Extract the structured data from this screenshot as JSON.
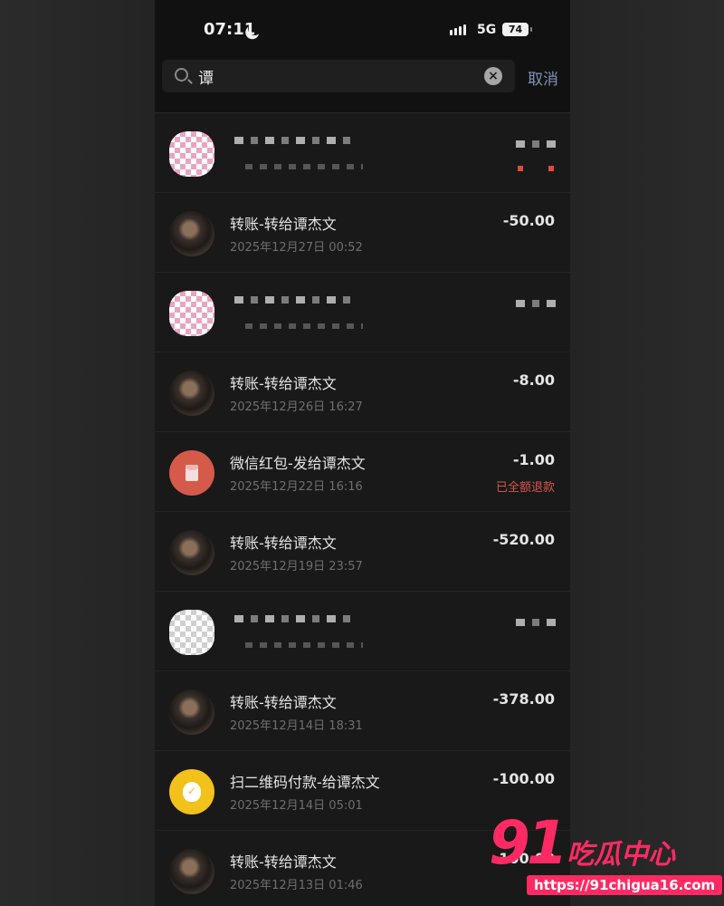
{
  "status_bar": {
    "time": "07:11",
    "network": "5G",
    "battery": "74"
  },
  "search": {
    "query": "谭",
    "cancel_label": "取消"
  },
  "transactions": [
    {
      "title": "",
      "date": "",
      "amount": "",
      "avatar": "pixel-avatar",
      "redacted": true
    },
    {
      "title": "转账-转给谭杰文",
      "date": "2025年12月27日 00:52",
      "amount": "-50.00",
      "avatar": "photo-avatar"
    },
    {
      "title": "",
      "date": "",
      "amount": "",
      "avatar": "pixel-avatar",
      "redacted": true
    },
    {
      "title": "转账-转给谭杰文",
      "date": "2025年12月26日 16:27",
      "amount": "-8.00",
      "avatar": "photo-avatar"
    },
    {
      "title": "微信红包-发给谭杰文",
      "date": "2025年12月22日 16:16",
      "amount": "-1.00",
      "status": "已全额退款",
      "avatar": "red-packet-icon"
    },
    {
      "title": "转账-转给谭杰文",
      "date": "2025年12月19日 23:57",
      "amount": "-520.00",
      "avatar": "photo-avatar"
    },
    {
      "title": "",
      "date": "",
      "amount": "",
      "avatar": "pixel-avatar",
      "redacted": true
    },
    {
      "title": "转账-转给谭杰文",
      "date": "2025年12月14日 18:31",
      "amount": "-378.00",
      "avatar": "photo-avatar"
    },
    {
      "title": "扫二维码付款-给谭杰文",
      "date": "2025年12月14日 05:01",
      "amount": "-100.00",
      "avatar": "qr-pay-icon"
    },
    {
      "title": "转账-转给谭杰文",
      "date": "2025年12月13日 01:46",
      "amount": "-100.00",
      "avatar": "photo-avatar"
    }
  ],
  "watermark": {
    "brand": "91",
    "name": "吃瓜中心",
    "url": "https://91chigua16.com"
  },
  "colors": {
    "accent_link": "#7d94b3",
    "refund_red": "#d8564b",
    "watermark": "#ff2a63"
  }
}
